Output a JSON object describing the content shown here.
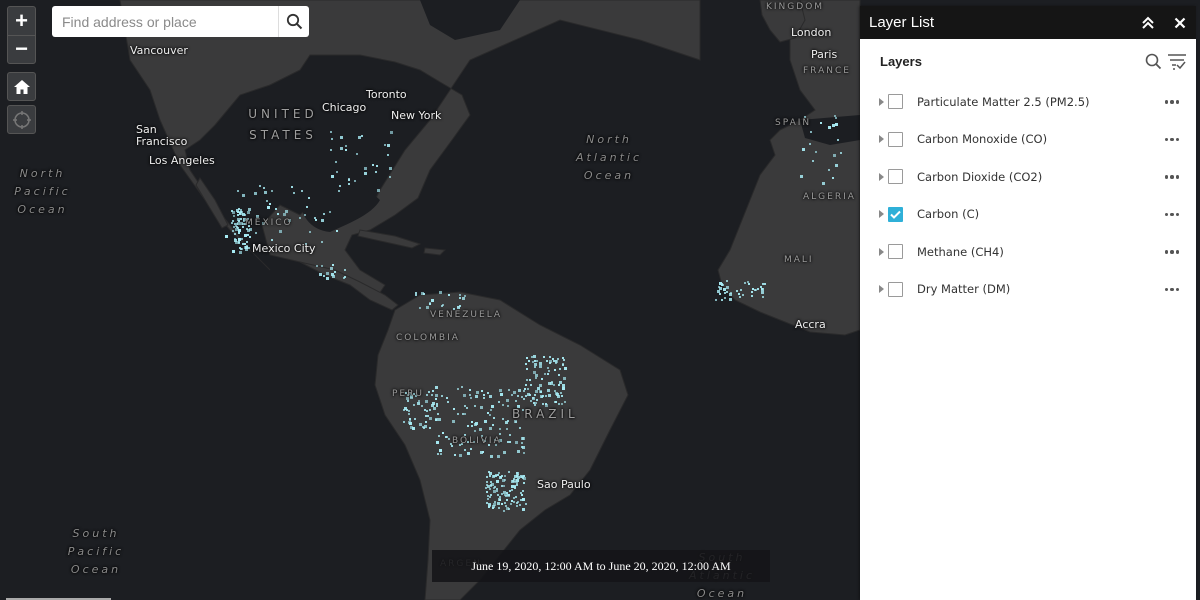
{
  "map": {
    "cities": [
      {
        "id": "vancouver",
        "name": "Vancouver"
      },
      {
        "id": "san-francisco",
        "name": "San\nFrancisco"
      },
      {
        "id": "los-angeles",
        "name": "Los Angeles"
      },
      {
        "id": "chicago",
        "name": "Chicago"
      },
      {
        "id": "toronto",
        "name": "Toronto"
      },
      {
        "id": "new-york",
        "name": "New York"
      },
      {
        "id": "mexico-city",
        "name": "Mexico City"
      },
      {
        "id": "sao-paulo",
        "name": "Sao Paulo"
      },
      {
        "id": "london",
        "name": "London"
      },
      {
        "id": "paris",
        "name": "Paris"
      },
      {
        "id": "accra",
        "name": "Accra"
      }
    ],
    "countries": [
      {
        "id": "united-states",
        "name": "UNITED\nSTATES"
      },
      {
        "id": "mexico",
        "name": "MÉXICO"
      },
      {
        "id": "venezuela",
        "name": "VENEZUELA"
      },
      {
        "id": "colombia",
        "name": "COLOMBIA"
      },
      {
        "id": "peru",
        "name": "PERU"
      },
      {
        "id": "brazil",
        "name": "BRAZIL"
      },
      {
        "id": "bolivia",
        "name": "BOLIVIA"
      },
      {
        "id": "argentina",
        "name": "ARGEN"
      },
      {
        "id": "kingdom",
        "name": "KINGDOM"
      },
      {
        "id": "france",
        "name": "FRANCE"
      },
      {
        "id": "spain",
        "name": "SPAIN"
      },
      {
        "id": "algeria",
        "name": "ALGERIA"
      },
      {
        "id": "mali",
        "name": "MALI"
      }
    ],
    "oceans": [
      {
        "id": "north-pacific",
        "name": "North Pacific Ocean"
      },
      {
        "id": "north-atlantic",
        "name": "North Atlantic Ocean"
      },
      {
        "id": "south-pacific",
        "name": "South Pacific Ocean"
      },
      {
        "id": "south-atlantic",
        "name": "South Atlantic Ocean"
      }
    ],
    "hotspot_color": "#a8ecf5"
  },
  "controls": {
    "zoom_in": "+",
    "zoom_out": "−",
    "home_icon": "home-icon",
    "locate_icon": "locate-icon"
  },
  "search": {
    "placeholder": "Find address or place",
    "value": ""
  },
  "time_extent": "June 19, 2020, 12:00 AM to June 20, 2020, 12:00 AM",
  "layer_list": {
    "title": "Layer List",
    "section_title": "Layers",
    "accent_color": "#2fb0d8",
    "layers": [
      {
        "name": "Particulate Matter 2.5 (PM2.5)",
        "checked": false
      },
      {
        "name": "Carbon Monoxide (CO)",
        "checked": false
      },
      {
        "name": "Carbon Dioxide (CO2)",
        "checked": false
      },
      {
        "name": "Carbon (C)",
        "checked": true
      },
      {
        "name": "Methane (CH4)",
        "checked": false
      },
      {
        "name": "Dry Matter (DM)",
        "checked": false
      }
    ]
  }
}
